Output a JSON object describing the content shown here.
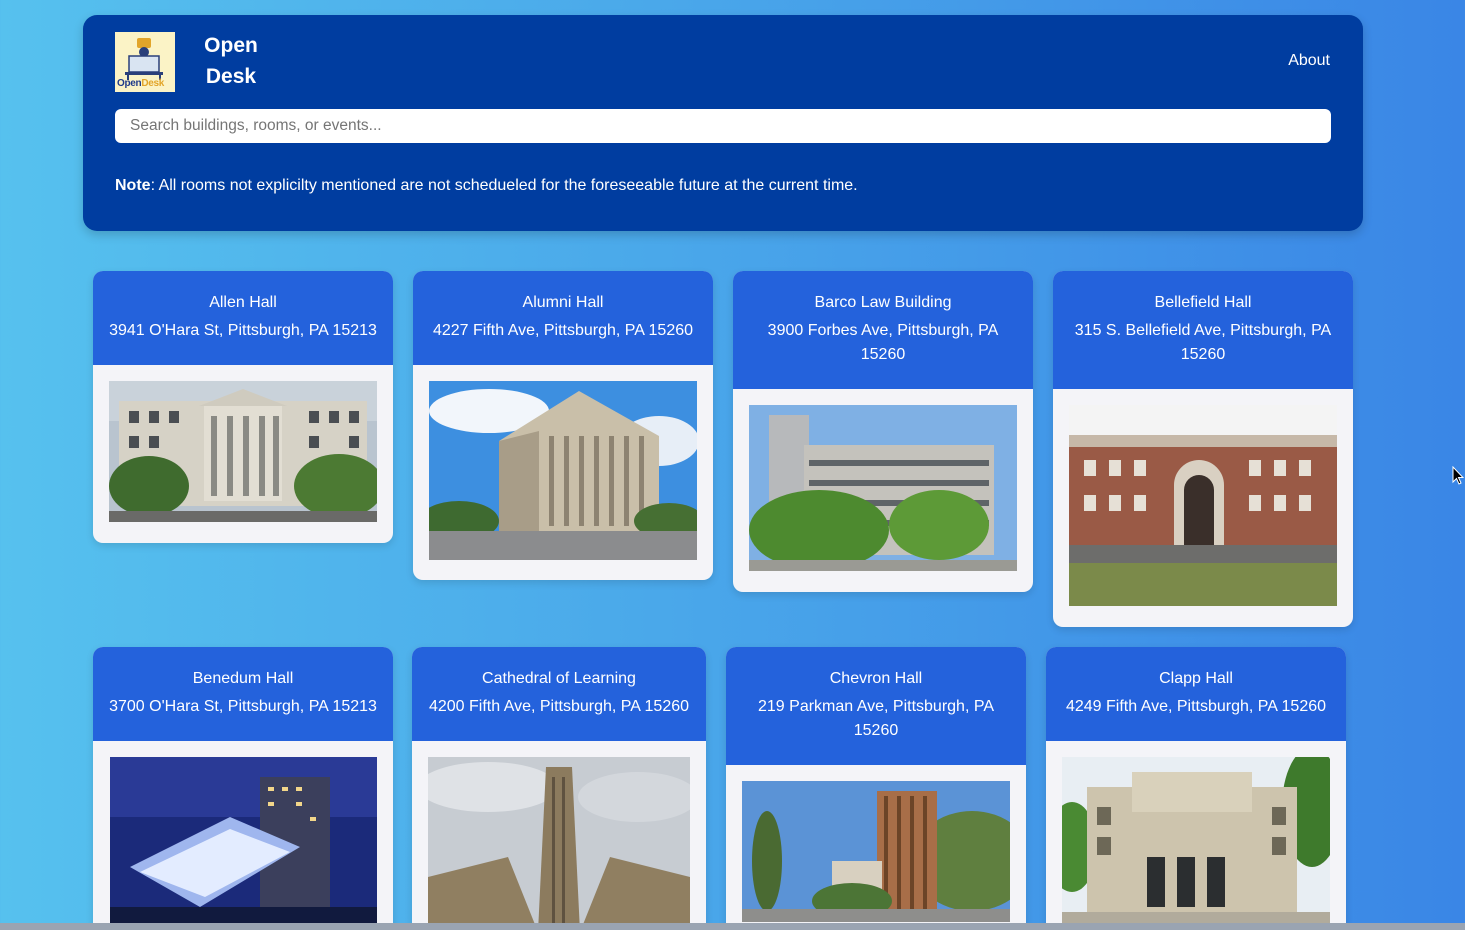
{
  "header": {
    "logo_text_a": "Open",
    "logo_text_b": "Desk",
    "brand_line1": "Open",
    "brand_line2": "Desk",
    "about_label": "About",
    "search_placeholder": "Search buildings, rooms, or events...",
    "note_label": "Note",
    "note_text": ": All rooms not explicilty mentioned are not schedueled for the foreseeable future at the current time."
  },
  "buildings": [
    {
      "name": "Allen Hall",
      "address": "3941 O'Hara St, Pittsburgh, PA 15213"
    },
    {
      "name": "Alumni Hall",
      "address": "4227 Fifth Ave, Pittsburgh, PA 15260"
    },
    {
      "name": "Barco Law Building",
      "address": "3900 Forbes Ave, Pittsburgh, PA 15260"
    },
    {
      "name": "Bellefield Hall",
      "address": "315 S. Bellefield Ave, Pittsburgh, PA 15260"
    },
    {
      "name": "Benedum Hall",
      "address": "3700 O'Hara St, Pittsburgh, PA 15213"
    },
    {
      "name": "Cathedral of Learning",
      "address": "4200 Fifth Ave, Pittsburgh, PA 15260"
    },
    {
      "name": "Chevron Hall",
      "address": "219 Parkman Ave, Pittsburgh, PA 15260"
    },
    {
      "name": "Clapp Hall",
      "address": "4249 Fifth Ave, Pittsburgh, PA 15260"
    }
  ]
}
